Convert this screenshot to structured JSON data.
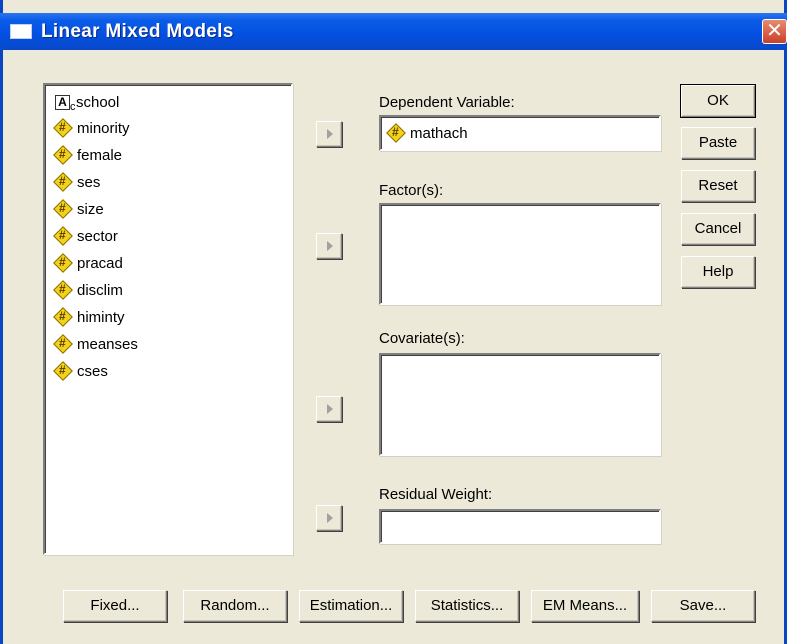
{
  "window": {
    "title": "Linear Mixed Models",
    "close_glyph": "✕"
  },
  "variables": [
    {
      "name": "school",
      "type": "string"
    },
    {
      "name": "minority",
      "type": "numeric"
    },
    {
      "name": "female",
      "type": "numeric"
    },
    {
      "name": "ses",
      "type": "numeric"
    },
    {
      "name": "size",
      "type": "numeric"
    },
    {
      "name": "sector",
      "type": "numeric"
    },
    {
      "name": "pracad",
      "type": "numeric"
    },
    {
      "name": "disclim",
      "type": "numeric"
    },
    {
      "name": "himinty",
      "type": "numeric"
    },
    {
      "name": "meanses",
      "type": "numeric"
    },
    {
      "name": "cses",
      "type": "numeric"
    }
  ],
  "string_icon_letter": "A",
  "dependent": {
    "label": "Dependent Variable:",
    "value": "mathach"
  },
  "factors": {
    "label": "Factor(s):"
  },
  "covariates": {
    "label": "Covariate(s):"
  },
  "residual_weight": {
    "label": "Residual Weight:"
  },
  "side_buttons": {
    "ok": "OK",
    "paste": "Paste",
    "reset": "Reset",
    "cancel": "Cancel",
    "help": "Help"
  },
  "bottom_buttons": {
    "fixed": "Fixed...",
    "random": "Random...",
    "estimation": "Estimation...",
    "statistics": "Statistics...",
    "em_means": "EM Means...",
    "save": "Save..."
  },
  "colors": {
    "titlebar": "#0350e0",
    "dialog_bg": "#ece9d8",
    "numeric_icon": "#f2d21a",
    "close_button": "#c9402a"
  }
}
